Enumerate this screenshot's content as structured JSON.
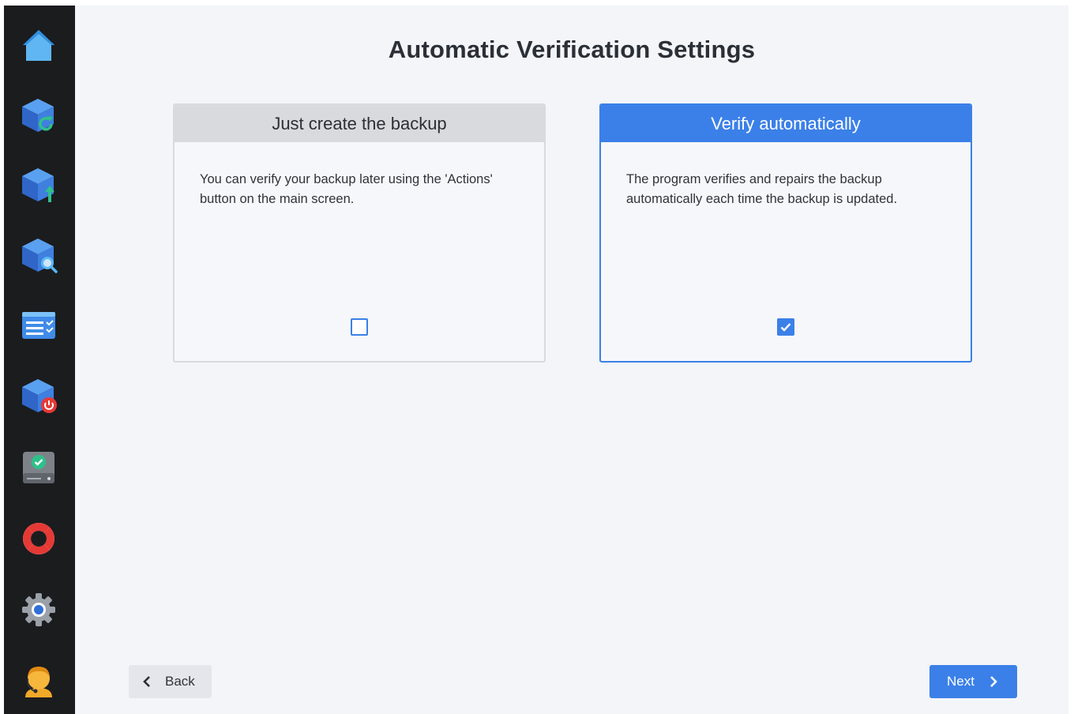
{
  "sidebar": {
    "items": [
      {
        "icon": "home-icon"
      },
      {
        "icon": "backup-refresh-icon"
      },
      {
        "icon": "backup-upload-icon"
      },
      {
        "icon": "backup-search-icon"
      },
      {
        "icon": "task-list-icon"
      },
      {
        "icon": "backup-power-icon"
      },
      {
        "icon": "drive-check-icon"
      },
      {
        "icon": "lifebuoy-icon"
      },
      {
        "icon": "gear-icon"
      },
      {
        "icon": "support-agent-icon"
      }
    ]
  },
  "page": {
    "title": "Automatic Verification Settings"
  },
  "options": [
    {
      "title": "Just create the backup",
      "description": "You can verify your backup later using the 'Actions' button on the main screen.",
      "checked": false
    },
    {
      "title": "Verify automatically",
      "description": "The program verifies and repairs the backup automatically each time the backup is updated.",
      "checked": true
    }
  ],
  "footer": {
    "back_label": "Back",
    "next_label": "Next"
  },
  "colors": {
    "accent": "#3b80e8",
    "sidebar": "#1b1c1e",
    "background": "#f3f5f9"
  }
}
